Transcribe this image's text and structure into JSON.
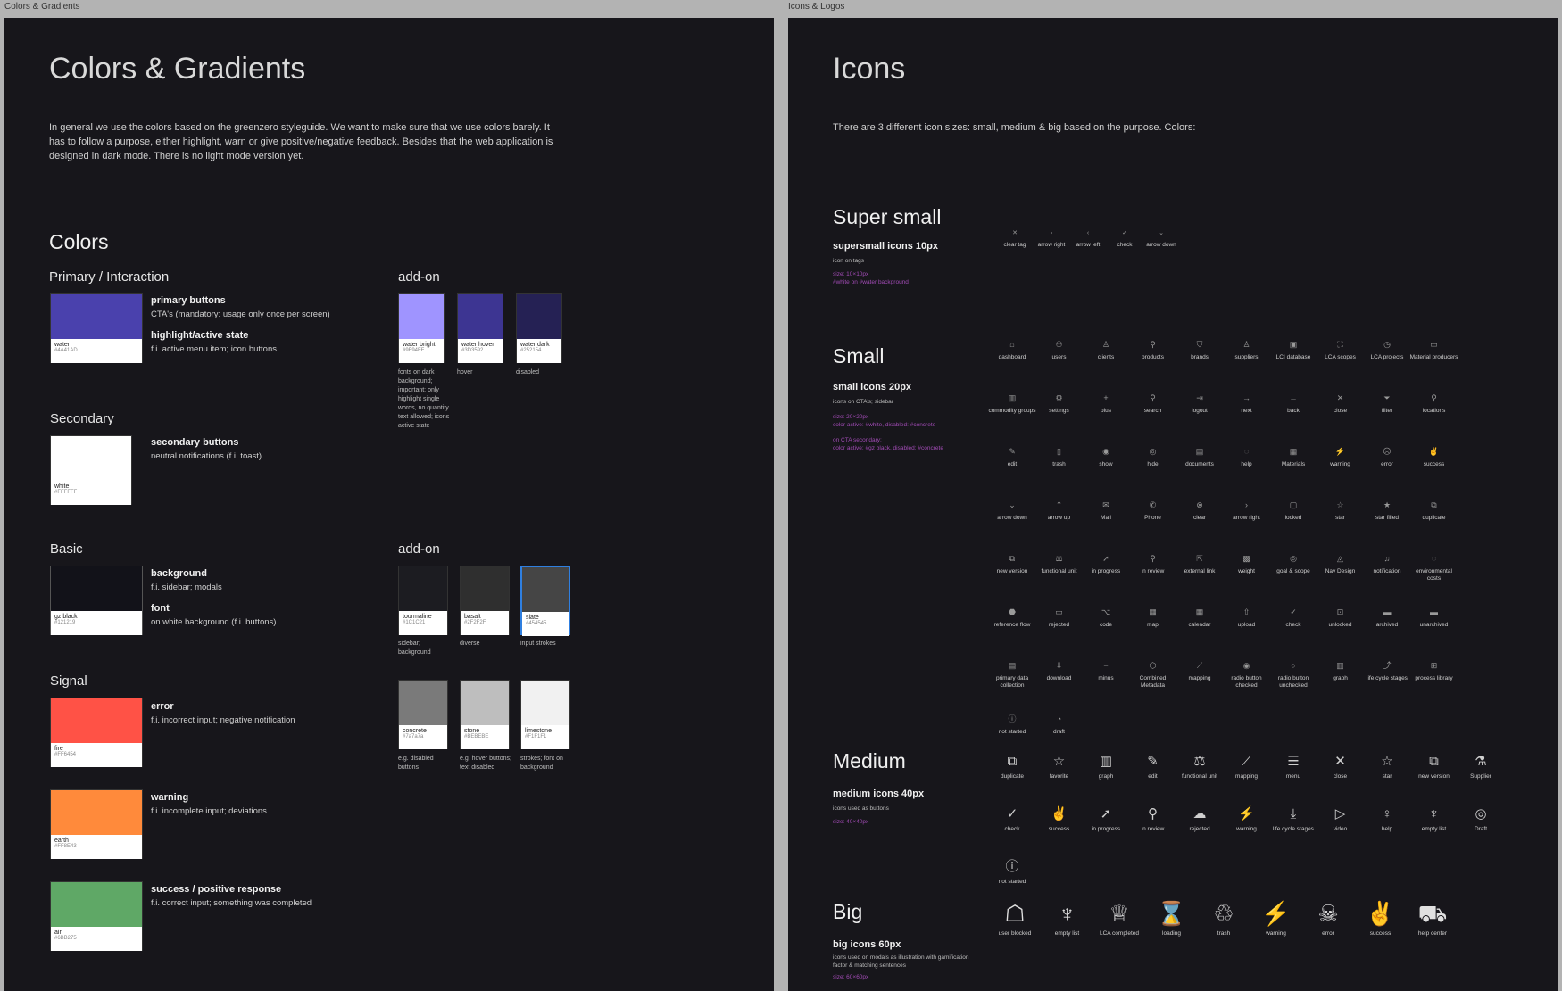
{
  "frames": {
    "left_label": "Colors & Gradients",
    "right_label": "Icons & Logos"
  },
  "colors": {
    "title": "Colors & Gradients",
    "intro": "In general we use the colors based on the greenzero styleguide. We want to make sure that we use colors barely. It has to follow a purpose, either highlight, warn or give positive/negative feedback. Besides that the web application is designed in dark mode. There is no light mode version yet.",
    "section_title": "Colors",
    "primary": {
      "title": "Primary / Interaction",
      "swatch": {
        "name": "water",
        "hex": "#4A41AD",
        "color": "#4a41ad"
      },
      "desc1_title": "primary buttons",
      "desc1_sub": "CTA's (mandatory: usage only once per screen)",
      "desc2_title": "highlight/active state",
      "desc2_sub": "f.i. active menu item; icon buttons"
    },
    "addon1": {
      "title": "add-on",
      "swatches": [
        {
          "name": "water bright",
          "hex": "#9F94FF",
          "color": "#9f94ff",
          "note": "fonts on dark background; important: only highlight single words, no quantity text allowed; icons active state"
        },
        {
          "name": "water hover",
          "hex": "#3D3592",
          "color": "#3d3592",
          "note": "hover"
        },
        {
          "name": "water dark",
          "hex": "#252154",
          "color": "#252154",
          "note": "disabled"
        }
      ]
    },
    "secondary": {
      "title": "Secondary",
      "swatch": {
        "name": "white",
        "hex": "#FFFFFF",
        "color": "#ffffff"
      },
      "desc_title": "secondary buttons",
      "desc_sub": "neutral notifications (f.i. toast)"
    },
    "basic": {
      "title": "Basic",
      "swatch": {
        "name": "gz black",
        "hex": "#121219",
        "color": "#121219"
      },
      "desc1_title": "background",
      "desc1_sub": "f.i. sidebar; modals",
      "desc2_title": "font",
      "desc2_sub": "on white background (f.i. buttons)"
    },
    "addon2": {
      "title": "add-on",
      "swatches": [
        {
          "name": "tourmaline",
          "hex": "#1C1C21",
          "color": "#1c1c21",
          "note": "sidebar; background"
        },
        {
          "name": "basalt",
          "hex": "#2F2F2F",
          "color": "#2f2f2f",
          "note": "diverse"
        },
        {
          "name": "slate",
          "hex": "#454545",
          "color": "#454545",
          "note": "input strokes"
        },
        {
          "name": "concrete",
          "hex": "#7a7a7a",
          "color": "#7a7a7a",
          "note": "e.g. disabled buttons"
        },
        {
          "name": "stone",
          "hex": "#BEBEBE",
          "color": "#bebebe",
          "note": "e.g. hover buttons; text disabled"
        },
        {
          "name": "limestone",
          "hex": "#F1F1F1",
          "color": "#f1f1f1",
          "note": "strokes; font on background"
        }
      ]
    },
    "signal": {
      "title": "Signal",
      "items": [
        {
          "name": "fire",
          "hex": "#FF6454",
          "color": "#ff5246",
          "desc_title": "error",
          "desc_sub": "f.i. incorrect input; negative notification"
        },
        {
          "name": "earth",
          "hex": "#FF8E43",
          "color": "#ff8a3b",
          "desc_title": "warning",
          "desc_sub": "f.i. incomplete input; deviations"
        },
        {
          "name": "air",
          "hex": "#6BB275",
          "color": "#5fa866",
          "desc_title": "success / positive response",
          "desc_sub": "f.i. correct input; something was completed"
        }
      ]
    }
  },
  "icons": {
    "title": "Icons",
    "intro": "There are 3 different icon sizes: small, medium & big based on the purpose. Colors:",
    "super_small": {
      "title": "Super small",
      "sub": "supersmall icons 10px",
      "tag": "icon on tags",
      "pink1": "size: 10×10px",
      "pink2": "#white on #water background",
      "items": [
        {
          "glyph": "✕",
          "label": "clear tag"
        },
        {
          "glyph": "›",
          "label": "arrow right"
        },
        {
          "glyph": "‹",
          "label": "arrow left"
        },
        {
          "glyph": "✓",
          "label": "check"
        },
        {
          "glyph": "⌄",
          "label": "arrow down"
        }
      ]
    },
    "small": {
      "title": "Small",
      "sub": "small icons 20px",
      "tag": "icons on CTA's; sidebar",
      "pink1": "size: 20×20px",
      "pink2": "color active: #white, disabled: #concrete",
      "pink3": "on CTA secondary:",
      "pink4": "color active: #gz black, disabled: #concrete",
      "items": [
        {
          "glyph": "⌂",
          "label": "dashboard"
        },
        {
          "glyph": "⚇",
          "label": "users"
        },
        {
          "glyph": "♙",
          "label": "clients"
        },
        {
          "glyph": "⚲",
          "label": "products"
        },
        {
          "glyph": "⛉",
          "label": "brands"
        },
        {
          "glyph": "♙",
          "label": "suppliers"
        },
        {
          "glyph": "▣",
          "label": "LCI database"
        },
        {
          "glyph": "⛶",
          "label": "LCA scopes"
        },
        {
          "glyph": "◷",
          "label": "LCA projects"
        },
        {
          "glyph": "▭",
          "label": "Material producers"
        },
        {
          "glyph": "▥",
          "label": "commodity groups"
        },
        {
          "glyph": "⚙",
          "label": "settings"
        },
        {
          "glyph": "+",
          "label": "plus"
        },
        {
          "glyph": "⚲",
          "label": "search"
        },
        {
          "glyph": "⇥",
          "label": "logout"
        },
        {
          "glyph": "→",
          "label": "next"
        },
        {
          "glyph": "←",
          "label": "back"
        },
        {
          "glyph": "✕",
          "label": "close"
        },
        {
          "glyph": "⏷",
          "label": "filter"
        },
        {
          "glyph": "⚲",
          "label": "locations"
        },
        {
          "glyph": "✎",
          "label": "edit"
        },
        {
          "glyph": "▯",
          "label": "trash"
        },
        {
          "glyph": "◉",
          "label": "show"
        },
        {
          "glyph": "◎",
          "label": "hide"
        },
        {
          "glyph": "▤",
          "label": "documents"
        },
        {
          "glyph": "◌",
          "label": "help"
        },
        {
          "glyph": "▦",
          "label": "Materials"
        },
        {
          "glyph": "⚡",
          "label": "warning"
        },
        {
          "glyph": "☹",
          "label": "error"
        },
        {
          "glyph": "✌",
          "label": "success"
        },
        {
          "glyph": "⌄",
          "label": "arrow down"
        },
        {
          "glyph": "⌃",
          "label": "arrow up"
        },
        {
          "glyph": "✉",
          "label": "Mail"
        },
        {
          "glyph": "✆",
          "label": "Phone"
        },
        {
          "glyph": "⊗",
          "label": "clear"
        },
        {
          "glyph": "›",
          "label": "arrow right"
        },
        {
          "glyph": "▢",
          "label": "locked"
        },
        {
          "glyph": "☆",
          "label": "star"
        },
        {
          "glyph": "★",
          "label": "star filled"
        },
        {
          "glyph": "⧉",
          "label": "duplicate"
        },
        {
          "glyph": "⧉",
          "label": "new version"
        },
        {
          "glyph": "⚖",
          "label": "functional unit"
        },
        {
          "glyph": "➚",
          "label": "in progress"
        },
        {
          "glyph": "⚲",
          "label": "in review"
        },
        {
          "glyph": "⇱",
          "label": "external link"
        },
        {
          "glyph": "▩",
          "label": "weight"
        },
        {
          "glyph": "◎",
          "label": "goal & scope"
        },
        {
          "glyph": "◬",
          "label": "Nav Design"
        },
        {
          "glyph": "♫",
          "label": "notification"
        },
        {
          "glyph": "◌",
          "label": "environmental costs"
        },
        {
          "glyph": "⬣",
          "label": "reference flow"
        },
        {
          "glyph": "▭",
          "label": "rejected"
        },
        {
          "glyph": "⌥",
          "label": "code"
        },
        {
          "glyph": "▦",
          "label": "map"
        },
        {
          "glyph": "▦",
          "label": "calendar"
        },
        {
          "glyph": "⇧",
          "label": "upload"
        },
        {
          "glyph": "✓",
          "label": "check"
        },
        {
          "glyph": "⊡",
          "label": "unlocked"
        },
        {
          "glyph": "▬",
          "label": "archived"
        },
        {
          "glyph": "▬",
          "label": "unarchived"
        },
        {
          "glyph": "▤",
          "label": "primary data collection"
        },
        {
          "glyph": "⇩",
          "label": "download"
        },
        {
          "glyph": "−",
          "label": "minus"
        },
        {
          "glyph": "⬡",
          "label": "Combined Metadata"
        },
        {
          "glyph": "⟋",
          "label": "mapping"
        },
        {
          "glyph": "◉",
          "label": "radio button checked"
        },
        {
          "glyph": "○",
          "label": "radio button unchecked"
        },
        {
          "glyph": "▥",
          "label": "graph"
        },
        {
          "glyph": "⤴",
          "label": "life cycle stages"
        },
        {
          "glyph": "⊞",
          "label": "process library"
        },
        {
          "glyph": "ⓘ",
          "label": "not started"
        },
        {
          "glyph": "◔",
          "label": "draft"
        }
      ]
    },
    "medium": {
      "title": "Medium",
      "sub": "medium icons 40px",
      "tag": "icons used as buttons",
      "pink1": "size: 40×40px",
      "items": [
        {
          "glyph": "⧉",
          "label": "duplicate"
        },
        {
          "glyph": "☆",
          "label": "favorite"
        },
        {
          "glyph": "▥",
          "label": "graph"
        },
        {
          "glyph": "✎",
          "label": "edit"
        },
        {
          "glyph": "⚖",
          "label": "functional unit"
        },
        {
          "glyph": "⟋",
          "label": "mapping"
        },
        {
          "glyph": "☰",
          "label": "menu"
        },
        {
          "glyph": "✕",
          "label": "close"
        },
        {
          "glyph": "☆",
          "label": "star"
        },
        {
          "glyph": "⧉",
          "label": "new version"
        },
        {
          "glyph": "⚗",
          "label": "Supplier"
        },
        {
          "glyph": "✓",
          "label": "check"
        },
        {
          "glyph": "✌",
          "label": "success"
        },
        {
          "glyph": "➚",
          "label": "in progress"
        },
        {
          "glyph": "⚲",
          "label": "in review"
        },
        {
          "glyph": "☁",
          "label": "rejected"
        },
        {
          "glyph": "⚡",
          "label": "warning"
        },
        {
          "glyph": "⤓",
          "label": "life cycle stages"
        },
        {
          "glyph": "▷",
          "label": "video"
        },
        {
          "glyph": "♀",
          "label": "help"
        },
        {
          "glyph": "♆",
          "label": "empty list"
        },
        {
          "glyph": "◎",
          "label": "Draft"
        },
        {
          "glyph": "ⓘ",
          "label": "not started"
        }
      ]
    },
    "big": {
      "title": "Big",
      "sub": "big icons 60px",
      "tag": "icons used on modals as illustration with gamification factor & matching sentences",
      "pink1": "size: 60×60px",
      "items": [
        {
          "glyph": "☖",
          "label": "user blocked"
        },
        {
          "glyph": "♆",
          "label": "empty list"
        },
        {
          "glyph": "♕",
          "label": "LCA completed"
        },
        {
          "glyph": "⌛",
          "label": "loading"
        },
        {
          "glyph": "♲",
          "label": "trash"
        },
        {
          "glyph": "⚡",
          "label": "warning"
        },
        {
          "glyph": "☠",
          "label": "error"
        },
        {
          "glyph": "✌",
          "label": "success"
        },
        {
          "glyph": "⛟",
          "label": "help center"
        }
      ]
    }
  }
}
